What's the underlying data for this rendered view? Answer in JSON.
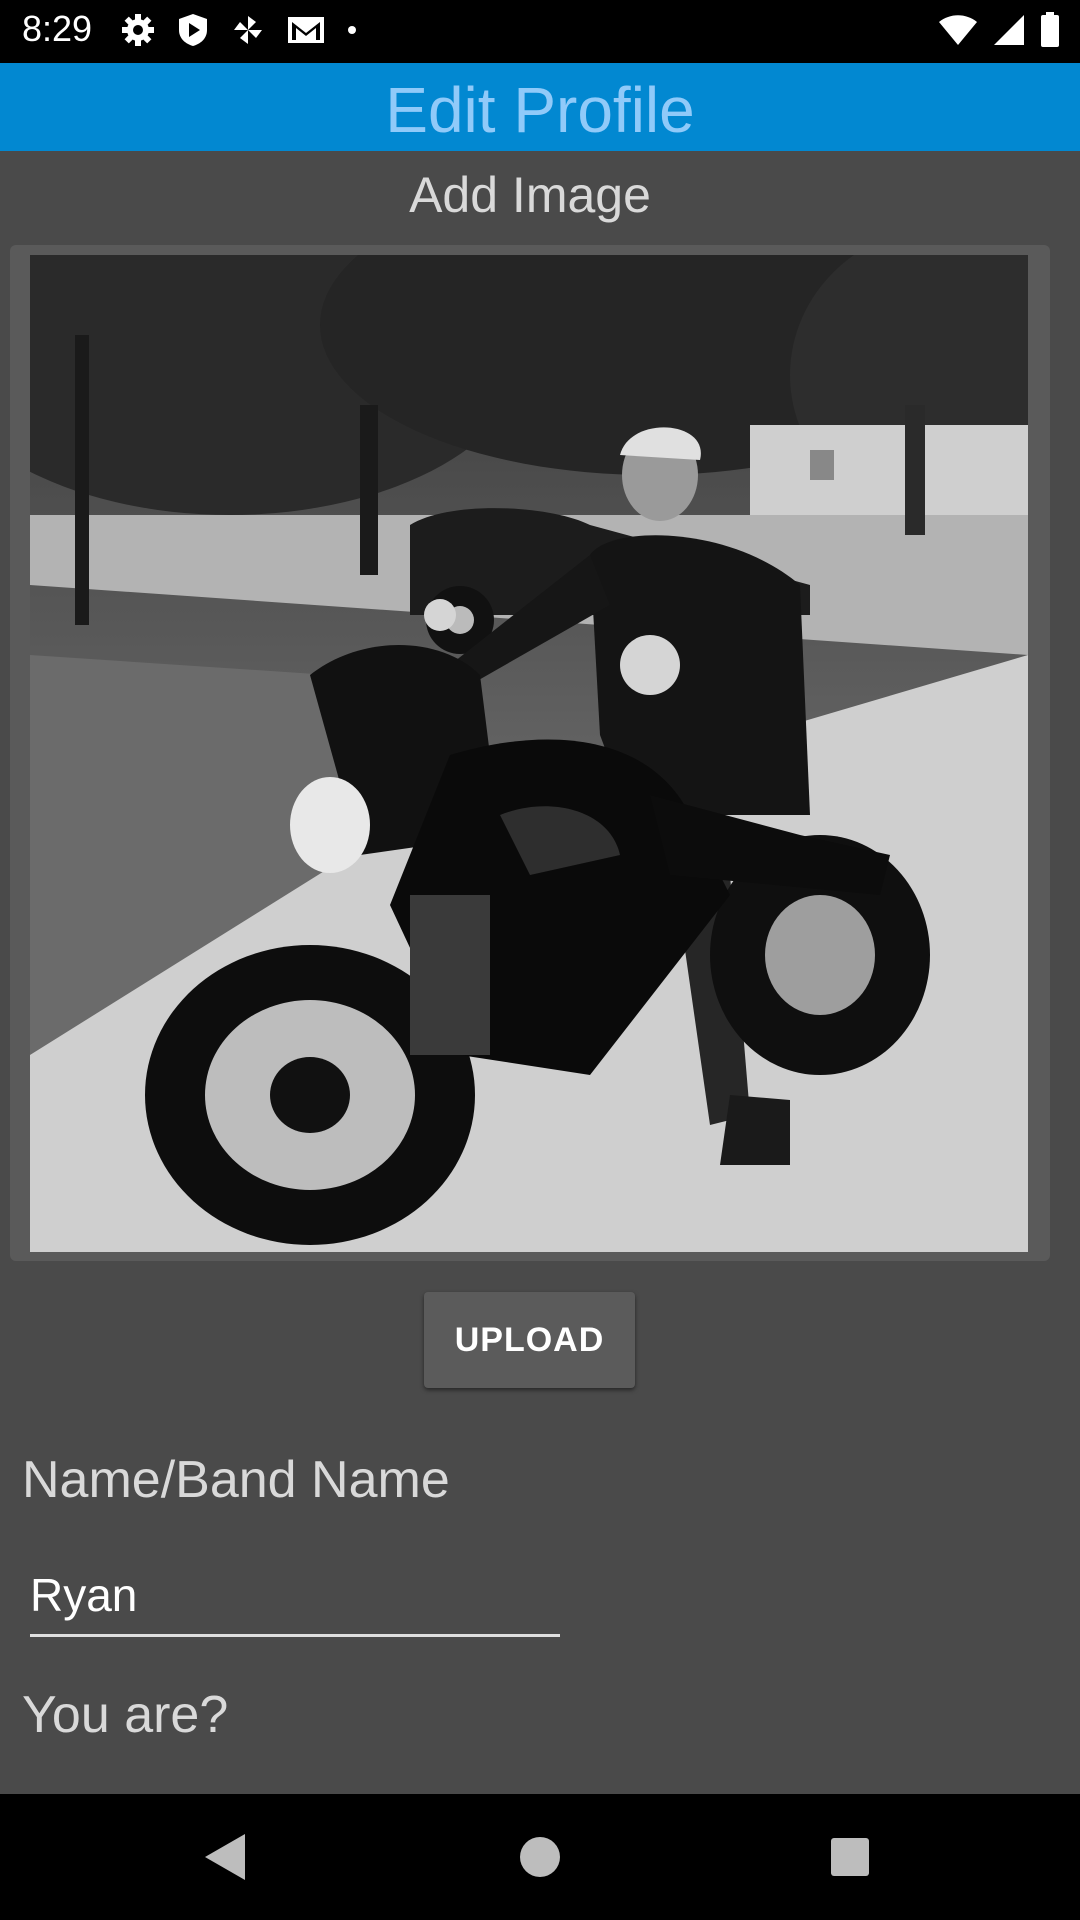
{
  "status_bar": {
    "time": "8:29",
    "left_icons": [
      "gear-icon",
      "play-protect-icon",
      "pinwheel-icon",
      "gmail-icon",
      "dot-icon"
    ],
    "right_icons": [
      "wifi-icon",
      "signal-icon",
      "battery-icon"
    ]
  },
  "app_bar": {
    "title": "Edit Profile",
    "background_color": "#0288d1",
    "title_color": "#90caf9"
  },
  "profile_image": {
    "section_label": "Add Image",
    "photo": "black-and-white photo of a man sitting on a motorcycle"
  },
  "upload_button": {
    "label": "UPLOAD"
  },
  "name_field": {
    "label": "Name/Band Name",
    "value": "Ryan"
  },
  "you_are": {
    "label": "You are?"
  },
  "nav_bar": {
    "buttons": [
      "back-icon",
      "home-icon",
      "recents-icon"
    ]
  }
}
